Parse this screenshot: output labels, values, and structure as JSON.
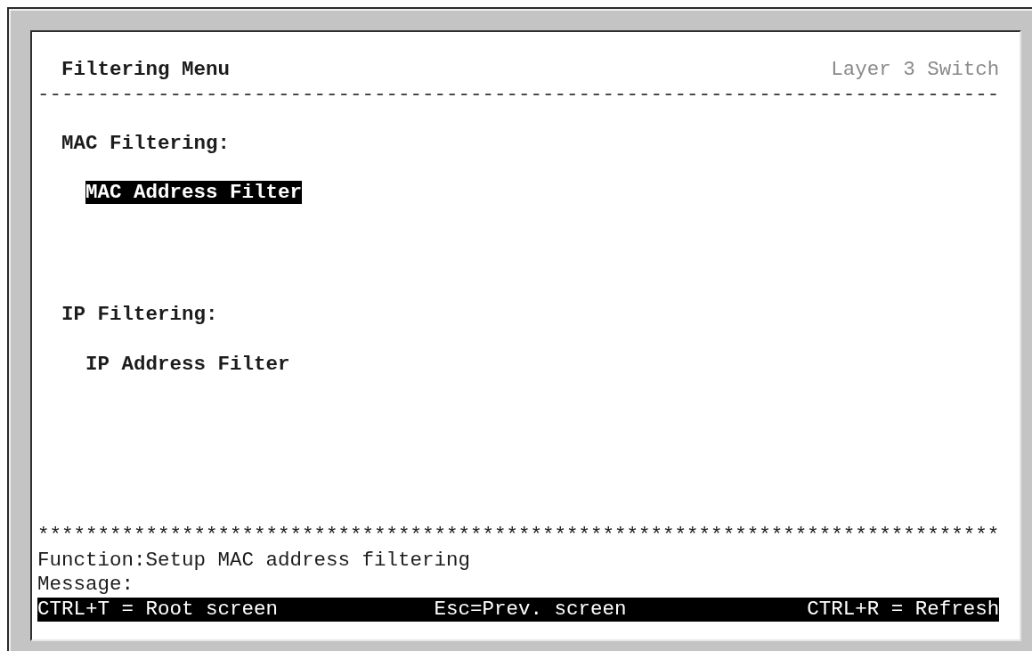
{
  "header": {
    "title": "Filtering Menu",
    "product": "Layer 3 Switch"
  },
  "separator": "--------------------------------------------------------------------------------",
  "sections": [
    {
      "heading": "MAC Filtering:",
      "items": [
        {
          "label": "MAC Address Filter",
          "selected": true
        }
      ]
    },
    {
      "heading": "IP Filtering:",
      "items": [
        {
          "label": "IP Address Filter",
          "selected": false
        }
      ]
    }
  ],
  "footer_separator": "********************************************************************************",
  "function_line": "Function:Setup MAC address filtering",
  "message_line": "Message:",
  "shortcuts": [
    "CTRL+T = Root screen",
    "Esc=Prev. screen",
    "CTRL+R = Refresh"
  ]
}
